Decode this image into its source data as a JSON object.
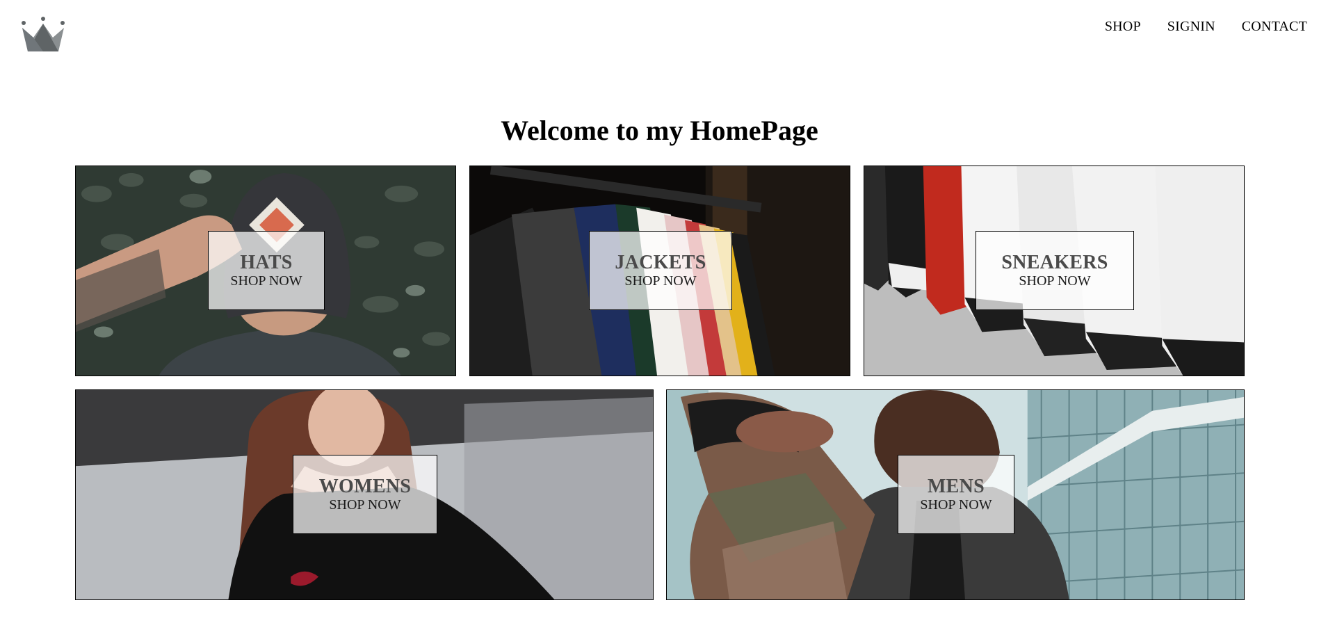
{
  "header": {
    "logo_icon": "crown-icon",
    "nav": {
      "shop": "SHOP",
      "signin": "SIGNIN",
      "contact": "CONTACT"
    }
  },
  "main": {
    "title": "Welcome to my HomePage",
    "categories": [
      {
        "title": "HATS",
        "cta": "SHOP NOW"
      },
      {
        "title": "JACKETS",
        "cta": "SHOP NOW"
      },
      {
        "title": "SNEAKERS",
        "cta": "SHOP NOW"
      },
      {
        "title": "WOMENS",
        "cta": "SHOP NOW"
      },
      {
        "title": "MENS",
        "cta": "SHOP NOW"
      }
    ]
  },
  "colors": {
    "logo": "#5f6466",
    "label_title": "#4a4a4a",
    "label_bg": "rgba(255,255,255,0.72)"
  }
}
